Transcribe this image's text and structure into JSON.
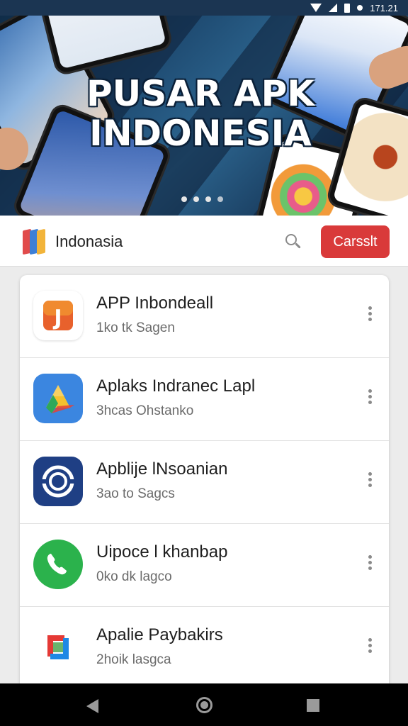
{
  "status_bar": {
    "time": "171.21"
  },
  "hero": {
    "title_line1": "PUSAR APK",
    "title_line2": "INDONESIA",
    "carousel_dots": 4,
    "active_dot": 0
  },
  "header": {
    "title": "Indonasia",
    "action_label": "Carsslt",
    "accent_color": "#d93a3a"
  },
  "apps": [
    {
      "title": "APP Inbondeall",
      "subtitle": "1ko tk Sagen",
      "icon": "music-note-icon"
    },
    {
      "title": "Aplaks Indranec Lapl",
      "subtitle": "3hcas Ohstanko",
      "icon": "drive-triangle-icon"
    },
    {
      "title": "Apblije lNsoanian",
      "subtitle": "3ao to Sagcs",
      "icon": "ring-badge-icon"
    },
    {
      "title": "Uipoce l khanbap",
      "subtitle": "0ko dk lagco",
      "icon": "phone-icon"
    },
    {
      "title": "Apalie Paybakirs",
      "subtitle": "2hoik lasgca",
      "icon": "square-logo-icon"
    }
  ],
  "navbar": {
    "items": [
      "back-icon",
      "home-icon",
      "recent-apps-icon"
    ]
  }
}
